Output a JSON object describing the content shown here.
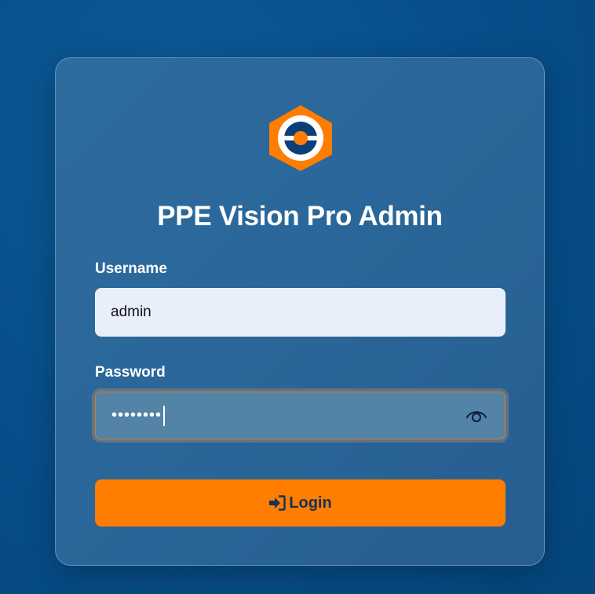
{
  "app": {
    "title": "PPE Vision Pro Admin"
  },
  "form": {
    "username_label": "Username",
    "username_value": "admin",
    "password_label": "Password",
    "password_masked": "••••••••",
    "login_label": "Login"
  },
  "icons": {
    "logo": "ppe-vision-logo-icon",
    "eye": "eye-icon",
    "login": "sign-in-icon"
  },
  "colors": {
    "background": "#07508d",
    "card": "#2a6598",
    "accent": "#ff7d00",
    "logo_dark": "#0b3f7a",
    "input_bg": "#e8effb",
    "button_text": "#173157"
  }
}
